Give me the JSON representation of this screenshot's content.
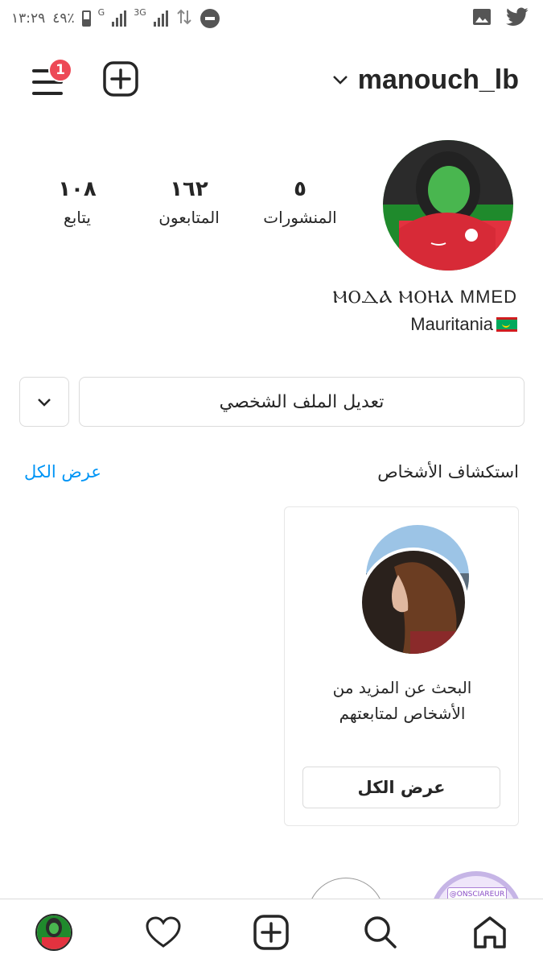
{
  "status_bar": {
    "time": "١٣:٢٩",
    "battery": "٤٩٪",
    "network_1": "G",
    "network_2": "3G",
    "icons": [
      "image-icon",
      "twitter-icon",
      "dnd-icon",
      "data-transfer-icon"
    ]
  },
  "header": {
    "username": "manouch_lb",
    "notification_count": "1"
  },
  "profile": {
    "stats": {
      "posts": {
        "value": "٥",
        "label": "المنشورات"
      },
      "followers": {
        "value": "١٦٢",
        "label": "المتابعون"
      },
      "following": {
        "value": "١٠٨",
        "label": "يتابع"
      }
    },
    "full_name": "ⲘⲞⲆⲀ ⲘⲞⲎⲀ MMED",
    "bio": "Mauritania",
    "edit_profile_label": "تعديل الملف الشخصي"
  },
  "discover": {
    "title": "استكشاف الأشخاص",
    "see_all": "عرض الكل",
    "card": {
      "text_line1": "البحث عن المزيد من",
      "text_line2": "الأشخاص لمتابعتهم",
      "button": "عرض الكل"
    },
    "peek_tag": "@ONSCIAREUR"
  },
  "bottom_nav": [
    "profile",
    "activity-heart",
    "create",
    "search",
    "home"
  ],
  "colors": {
    "accent_blue": "#0095f6",
    "badge_red": "#ed4956",
    "border": "#dbdbdb",
    "text": "#262626"
  }
}
